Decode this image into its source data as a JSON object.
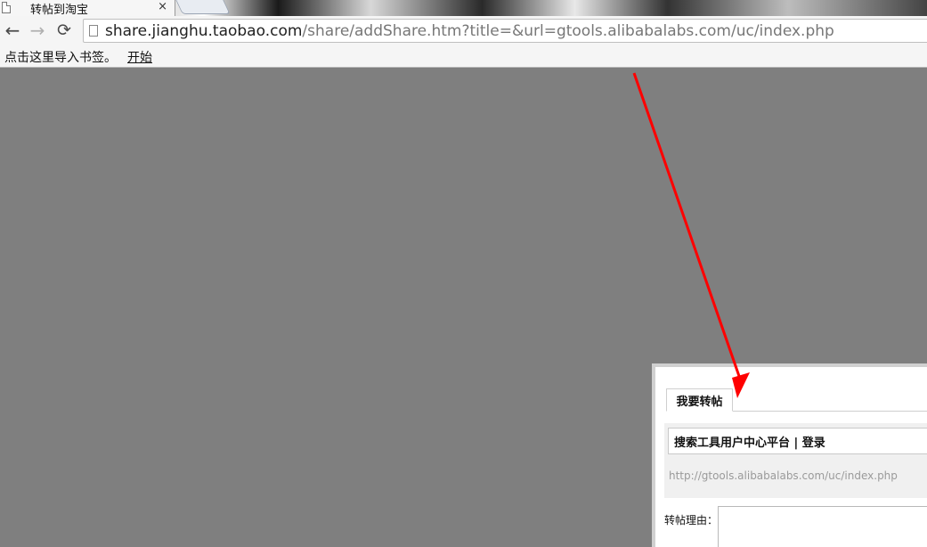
{
  "browser": {
    "tab": {
      "title": "转帖到淘宝",
      "close": "×"
    },
    "omnibox": {
      "host": "share.jianghu.taobao.com",
      "path": "/share/addShare.htm?title=&url=gtools.alibabalabs.com/uc/index.php"
    },
    "nav": {
      "back": "←",
      "forward": "→",
      "reload": "⟳"
    }
  },
  "bookmarks": {
    "hint": "点击这里导入书签。",
    "start_link": "开始"
  },
  "dialog": {
    "tab_label": "我要转帖",
    "share_title": "搜索工具用户中心平台 | 登录",
    "share_url": "http://gtools.alibabalabs.com/uc/index.php",
    "reason_label": "转帖理由："
  },
  "colors": {
    "overlay": "#7f7f7f",
    "arrow": "#ff0000"
  }
}
